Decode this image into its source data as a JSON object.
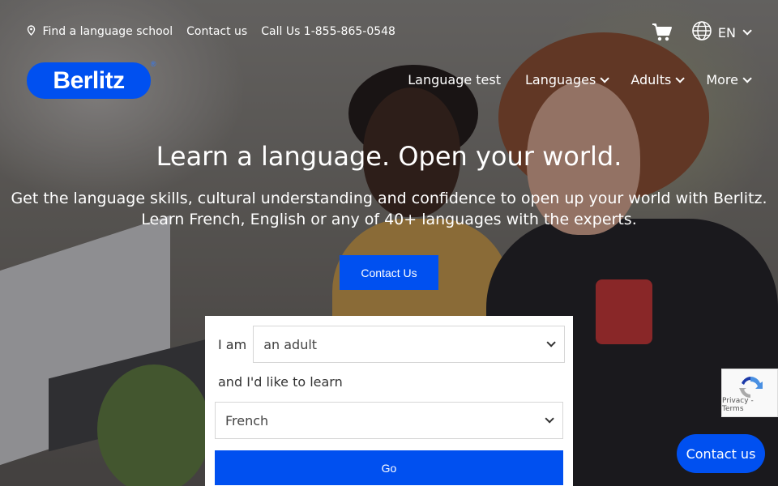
{
  "utility": {
    "find_school": "Find a language school",
    "contact": "Contact us",
    "phone": "Call Us 1-855-865-0548"
  },
  "language": {
    "current": "EN"
  },
  "logo": {
    "text": "Berlitz",
    "mark": "®"
  },
  "nav": [
    {
      "label": "Language test"
    },
    {
      "label": "Languages"
    },
    {
      "label": "Adults"
    },
    {
      "label": "More"
    }
  ],
  "hero": {
    "title": "Learn a language. Open your world.",
    "subtitle_line1": "Get the language skills, cultural understanding and confidence to open up your world with Berlitz.",
    "subtitle_line2": "Learn French, English or any of 40+ languages with the experts.",
    "cta": "Contact Us"
  },
  "form": {
    "i_am_label": "I am",
    "i_am_value": "an adult",
    "learn_label": "and I'd like to learn",
    "learn_value": "French",
    "go": "Go"
  },
  "recaptcha": {
    "links": "Privacy - Terms"
  },
  "floating": {
    "contact": "Contact us"
  },
  "colors": {
    "brand_blue": "#0050f0"
  },
  "icons": [
    "map-pin-icon",
    "cart-icon",
    "globe-icon",
    "chevron-down-icon",
    "recaptcha-icon"
  ]
}
